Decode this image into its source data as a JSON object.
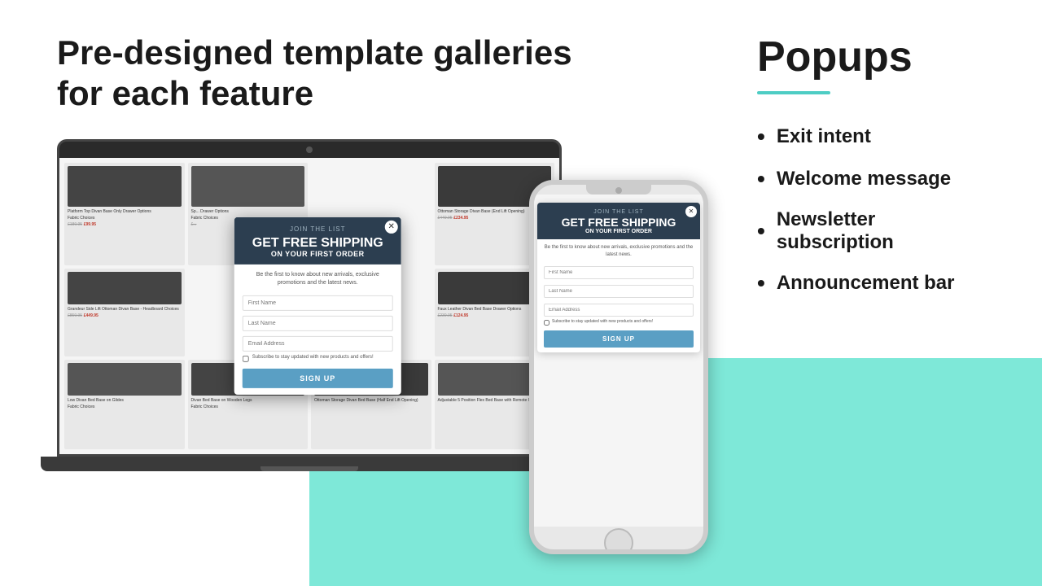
{
  "page": {
    "heading_line1": "Pre-designed template galleries",
    "heading_line2": "for each feature"
  },
  "right_panel": {
    "section_title": "Popups",
    "features": [
      "Exit intent",
      "Welcome message",
      "Newsletter subscription",
      "Announcement bar"
    ]
  },
  "popup": {
    "join_label": "JOIN THE LIST",
    "title": "GET FREE SHIPPING",
    "subtitle": "ON YOUR FIRST ORDER",
    "description": "Be the first to know about new arrivals, exclusive promotions and the latest news.",
    "first_name_placeholder": "First Name",
    "last_name_placeholder": "Last Name",
    "email_placeholder": "Email Address",
    "checkbox_label": "Subscribe to stay updated with new products and offers!",
    "button_label": "SIGN UP"
  },
  "products": [
    {
      "name": "Platform Top Divan Base Only Drawer Options",
      "price_old": "£189.95",
      "price_new": "£99.95"
    },
    {
      "name": "Ottoman Storage Divan Base (End Lift Opening)",
      "price_old": "£449.95",
      "price_new": "£234.95"
    },
    {
      "name": "Grandeur Side Lift Ottoman Divan Base - Headboard Choices",
      "price_old": "£859.95",
      "price_new": "£449.95"
    },
    {
      "name": "Faux Leather Divan Bed Base Drawer Options",
      "price_old": "£239.95",
      "price_new": "£124.95"
    }
  ]
}
